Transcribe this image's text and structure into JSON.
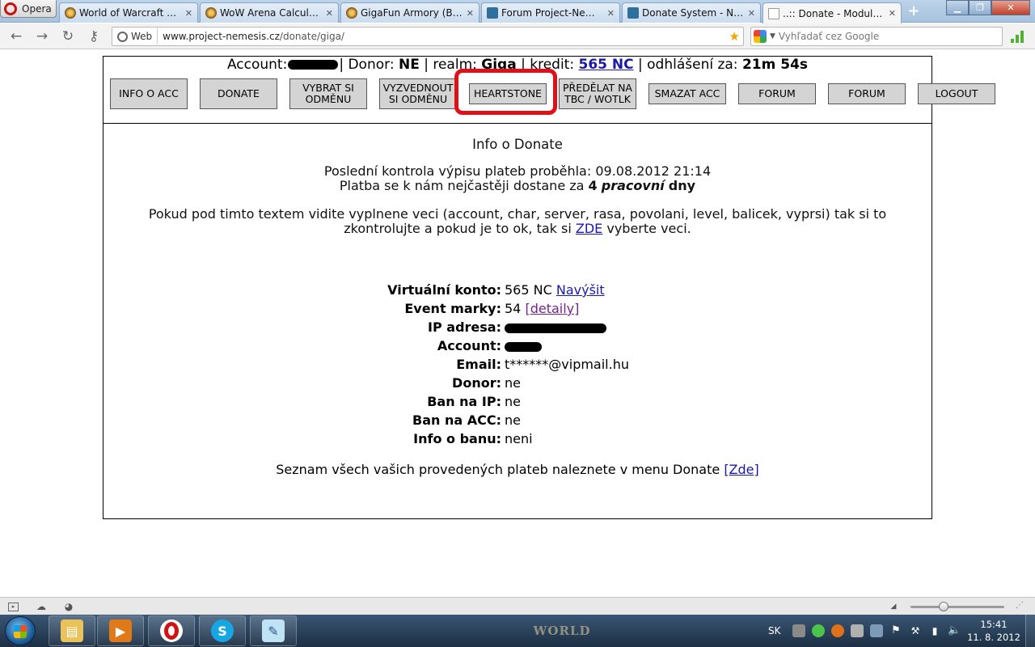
{
  "browser": {
    "menu_label": "Opera",
    "tabs": [
      {
        "title": "World of Warcraft » Ac...",
        "icon": "wow-icon"
      },
      {
        "title": "WoW Arena Calculator ...",
        "icon": "wow-icon"
      },
      {
        "title": "GigaFun Armory (BETA)",
        "icon": "wow-icon"
      },
      {
        "title": "Forum Project-Nemesis",
        "icon": "nemesis-icon"
      },
      {
        "title": "Donate System - Návo...",
        "icon": "nemesis-icon"
      },
      {
        "title": "..:: Donate - Modul ::...",
        "icon": "page-icon",
        "active": true
      }
    ],
    "address": {
      "chip_label": "Web",
      "url_host": "www.project-nemesis.cz",
      "url_path": "/donate/giga/"
    },
    "search_placeholder": "Vyhľadať cez Google"
  },
  "header": {
    "account_label": "Account:",
    "donor_label": "Donor:",
    "donor_value": "NE",
    "realm_label": "realm:",
    "realm_value": "Giga",
    "kredit_label": "kredit:",
    "kredit_value": "565 NC",
    "logout_label": "odhlášení za:",
    "logout_value": "21m 54s"
  },
  "menu": [
    {
      "label": "INFO O ACC",
      "highlighted": false
    },
    {
      "label": "DONATE",
      "highlighted": false
    },
    {
      "label": "VYBRAT SI ODMĚNU",
      "highlighted": false
    },
    {
      "label": "VYZVEDNOUT SI ODMĚNU",
      "highlighted": false
    },
    {
      "label": "HEARTSTONE",
      "highlighted": true
    },
    {
      "label": "PŘEDĚLAT NA TBC / WOTLK",
      "highlighted": false
    },
    {
      "label": "SMAZAT ACC",
      "highlighted": false
    },
    {
      "label": "FORUM",
      "highlighted": false
    },
    {
      "label": "FORUM",
      "highlighted": false
    },
    {
      "label": "LOGOUT",
      "highlighted": false
    }
  ],
  "content": {
    "title": "Info o Donate",
    "last_check": "Poslední kontrola výpisu plateb proběhla: 09.08.2012 21:14",
    "payment_pre": "Platba se k nám nejčastěji dostane za",
    "payment_days": "4",
    "payment_word": "pracovní",
    "payment_post": "dny",
    "notice_line1": "Pokud pod timto textem vidite vyplnene veci (account, char, server, rasa, povolani, level, balicek, vyprsi) tak si to",
    "notice_line2_pre": "zkontrolujte a pokud je to ok, tak si",
    "notice_link": "ZDE",
    "notice_line2_post": "vyberte veci.",
    "fields": [
      {
        "key": "Virtuální konto:",
        "value": "565 NC",
        "link": "Navýšit"
      },
      {
        "key": "Event marky:",
        "value": "54",
        "link": "[detaily]"
      },
      {
        "key": "IP adresa:",
        "value": "",
        "redacted": true
      },
      {
        "key": "Account:",
        "value": "",
        "redacted": true
      },
      {
        "key": "Email:",
        "value": "t******@vipmail.hu"
      },
      {
        "key": "Donor:",
        "value": "ne"
      },
      {
        "key": "Ban na IP:",
        "value": "ne"
      },
      {
        "key": "Ban na ACC:",
        "value": "ne"
      },
      {
        "key": "Info o banu:",
        "value": "neni"
      }
    ],
    "footer_pre": "Seznam všech vašich provedených plateb naleznete v menu Donate",
    "footer_link": "[Zde]"
  },
  "taskbar": {
    "language": "SK",
    "time": "15:41",
    "date": "11. 8. 2012",
    "pinned": [
      "explorer-icon",
      "media-player-icon",
      "opera-icon",
      "skype-icon",
      "notepad-icon"
    ]
  },
  "colors": {
    "link": "#1a1aa6",
    "visited_link": "#7a2090",
    "highlight_ring": "#e0101a",
    "menu_button_bg": "#d4d4d4"
  }
}
